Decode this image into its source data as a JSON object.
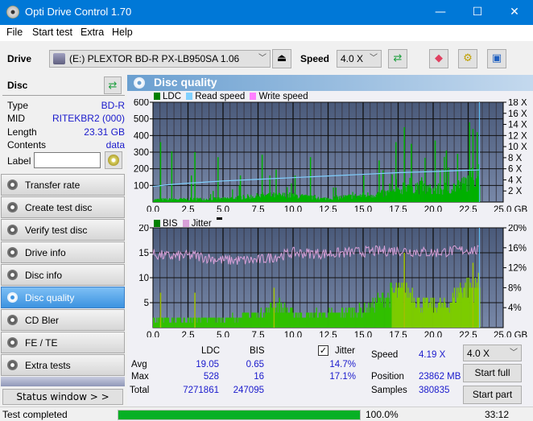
{
  "window": {
    "title": "Opti Drive Control 1.70",
    "minimize": "—",
    "maximize": "☐",
    "close": "✕"
  },
  "menu": [
    "File",
    "Start test",
    "Extra",
    "Help"
  ],
  "toolbar": {
    "drive_label": "Drive",
    "drive_value": "(E:)  PLEXTOR BD-R  PX-LB950SA 1.06",
    "speed_label": "Speed",
    "speed_value": "4.0 X"
  },
  "disc": {
    "title": "Disc",
    "type_label": "Type",
    "type_value": "BD-R",
    "mid_label": "MID",
    "mid_value": "RITEKBR2 (000)",
    "length_label": "Length",
    "length_value": "23.31 GB",
    "contents_label": "Contents",
    "contents_value": "data",
    "label_label": "Label",
    "label_value": ""
  },
  "nav": [
    {
      "label": "Transfer rate",
      "active": false
    },
    {
      "label": "Create test disc",
      "active": false
    },
    {
      "label": "Verify test disc",
      "active": false
    },
    {
      "label": "Drive info",
      "active": false
    },
    {
      "label": "Disc info",
      "active": false
    },
    {
      "label": "Disc quality",
      "active": true
    },
    {
      "label": "CD Bler",
      "active": false
    },
    {
      "label": "FE / TE",
      "active": false
    },
    {
      "label": "Extra tests",
      "active": false
    }
  ],
  "status_window_label": "Status window > >",
  "panel_title": "Disc quality",
  "colors": {
    "ldc": "#00b000",
    "read_speed": "#80d0ff",
    "write_speed": "#ff80ff",
    "bis": "#008000",
    "jitter": "#d8a0d8",
    "plot_bg_top": "#4a5a7a",
    "plot_bg_bottom": "#7888a8",
    "progress": "#06b025"
  },
  "chart_data": [
    {
      "type": "bar",
      "title": "LDC / Read speed",
      "legend": [
        "LDC",
        "Read speed",
        "Write speed"
      ],
      "xlabel": "GB",
      "x_ticks": [
        "0.0",
        "2.5",
        "5.0",
        "7.5",
        "10.0",
        "12.5",
        "15.0",
        "17.5",
        "20.0",
        "22.5",
        "25.0 GB"
      ],
      "xlim": [
        0,
        25
      ],
      "y_ticks_left": [
        "100",
        "200",
        "300",
        "400",
        "500",
        "600"
      ],
      "ylim_left": [
        0,
        600
      ],
      "y_ticks_right": [
        "2 X",
        "4 X",
        "6 X",
        "8 X",
        "10 X",
        "12 X",
        "14 X",
        "16 X",
        "18 X"
      ],
      "ylim_right": [
        0,
        18
      ],
      "ldc_spikes": [
        [
          0.5,
          360
        ],
        [
          1.3,
          305
        ],
        [
          2.7,
          160
        ],
        [
          2.95,
          300
        ],
        [
          4.6,
          270
        ],
        [
          6.2,
          160
        ],
        [
          7.75,
          285
        ],
        [
          8.3,
          160
        ],
        [
          8.75,
          195
        ],
        [
          10.1,
          160
        ],
        [
          11.2,
          270
        ],
        [
          15.0,
          160
        ],
        [
          16.1,
          250
        ],
        [
          17.3,
          360
        ],
        [
          17.9,
          450
        ],
        [
          18.4,
          350
        ],
        [
          20.1,
          370
        ],
        [
          20.9,
          310
        ],
        [
          21.7,
          290
        ],
        [
          22.8,
          440
        ],
        [
          23.1,
          420
        ]
      ],
      "ldc_baseline": [
        [
          0,
          15
        ],
        [
          5,
          20
        ],
        [
          8,
          40
        ],
        [
          10,
          40
        ],
        [
          12,
          20
        ],
        [
          15,
          40
        ],
        [
          17.5,
          60
        ],
        [
          18,
          110
        ],
        [
          20,
          70
        ],
        [
          22,
          100
        ],
        [
          23.3,
          180
        ]
      ],
      "read_speed": [
        [
          0,
          2.8
        ],
        [
          1,
          3.1
        ],
        [
          2.5,
          3.4
        ],
        [
          5,
          3.8
        ],
        [
          7.5,
          4.1
        ],
        [
          10,
          4.4
        ],
        [
          12.5,
          4.7
        ],
        [
          15,
          5.0
        ],
        [
          17.5,
          5.3
        ],
        [
          20,
          5.5
        ],
        [
          22,
          5.7
        ],
        [
          23.3,
          5.8
        ]
      ],
      "end_position_gb": 23.3
    },
    {
      "type": "bar",
      "title": "BIS / Jitter",
      "legend": [
        "BIS",
        "Jitter"
      ],
      "xlabel": "GB",
      "x_ticks": [
        "0.0",
        "2.5",
        "5.0",
        "7.5",
        "10.0",
        "12.5",
        "15.0",
        "17.5",
        "20.0",
        "22.5",
        "25.0 GB"
      ],
      "xlim": [
        0,
        25
      ],
      "y_ticks_left": [
        "5",
        "10",
        "15",
        "20"
      ],
      "ylim_left": [
        0,
        20
      ],
      "y_ticks_right": [
        "4%",
        "8%",
        "12%",
        "16%",
        "20%"
      ],
      "ylim_right": [
        0,
        20
      ],
      "bis_baseline": [
        [
          0,
          2
        ],
        [
          5,
          2
        ],
        [
          7.5,
          3
        ],
        [
          9,
          5
        ],
        [
          10,
          3
        ],
        [
          12.5,
          3
        ],
        [
          15,
          4
        ],
        [
          17.3,
          8
        ],
        [
          18.5,
          8
        ],
        [
          19,
          5
        ],
        [
          21,
          5
        ],
        [
          22,
          9
        ],
        [
          23.3,
          9
        ]
      ],
      "bis_spikes": [
        [
          0.5,
          7
        ],
        [
          2.95,
          7
        ],
        [
          8.6,
          8
        ],
        [
          17.9,
          15
        ],
        [
          22.8,
          13
        ],
        [
          23.2,
          11
        ]
      ],
      "jitter": [
        [
          0,
          14.7
        ],
        [
          1,
          14.3
        ],
        [
          3,
          14.4
        ],
        [
          5,
          13.5
        ],
        [
          7.5,
          13.5
        ],
        [
          10,
          15
        ],
        [
          12.5,
          14.8
        ],
        [
          15,
          15.2
        ],
        [
          17.5,
          15.5
        ],
        [
          20,
          15
        ],
        [
          22.5,
          15.6
        ],
        [
          23.3,
          15.4
        ]
      ],
      "end_position_gb": 23.3
    }
  ],
  "stats": {
    "col_ldc": "LDC",
    "col_bis": "BIS",
    "avg_label": "Avg",
    "max_label": "Max",
    "total_label": "Total",
    "ldc_avg": "19.05",
    "ldc_max": "528",
    "ldc_total": "7271861",
    "bis_avg": "0.65",
    "bis_max": "16",
    "bis_total": "247095",
    "jitter_label": "Jitter",
    "jitter_checked": true,
    "jitter_avg": "14.7%",
    "jitter_max": "17.1%",
    "speed_label": "Speed",
    "speed_value": "4.19 X",
    "position_label": "Position",
    "position_value": "23862 MB",
    "samples_label": "Samples",
    "samples_value": "380835",
    "speed_select": "4.0 X",
    "start_full": "Start full",
    "start_part": "Start part"
  },
  "statusbar": {
    "text": "Test completed",
    "progress": 100.0,
    "progress_text": "100.0%",
    "time": "33:12"
  }
}
